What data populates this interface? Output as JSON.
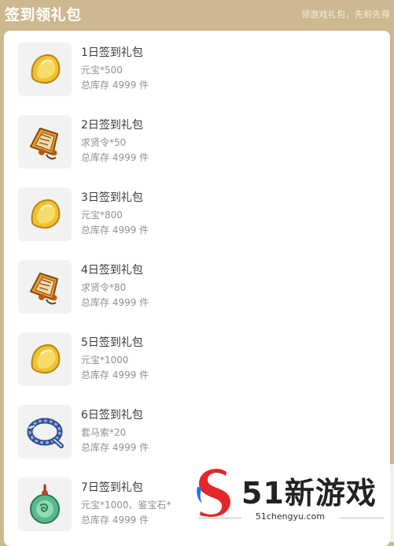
{
  "header": {
    "title": "签到领礼包",
    "note": "领游戏礼包，先到先得"
  },
  "rewards": [
    {
      "title": "1日签到礼包",
      "desc": "元宝*500",
      "stock": "总库存 4999 件",
      "icon": "gold-ingot-icon"
    },
    {
      "title": "2日签到礼包",
      "desc": "求贤令*50",
      "stock": "总库存 4999 件",
      "icon": "recruit-token-icon"
    },
    {
      "title": "3日签到礼包",
      "desc": "元宝*800",
      "stock": "总库存 4999 件",
      "icon": "gold-ingot-icon"
    },
    {
      "title": "4日签到礼包",
      "desc": "求贤令*80",
      "stock": "总库存 4999 件",
      "icon": "recruit-token-icon"
    },
    {
      "title": "5日签到礼包",
      "desc": "元宝*1000",
      "stock": "总库存 4999 件",
      "icon": "gold-ingot-icon"
    },
    {
      "title": "6日签到礼包",
      "desc": "套马索*20",
      "stock": "总库存 4999 件",
      "icon": "lasso-rope-icon"
    },
    {
      "title": "7日签到礼包",
      "desc": "元宝*1000、鉴宝石*",
      "stock": "总库存 4999 件",
      "icon": "jade-pendant-icon"
    }
  ],
  "watermark": {
    "brand": "51新游戏",
    "url": "51chengyu.com",
    "logo_icon": "s-swirl-logo"
  },
  "colors": {
    "background": "#cdb890",
    "panel": "#ffffff",
    "thumb_bg": "#f2f2f2",
    "title_text": "#3a3a3a",
    "meta_text": "#909090",
    "logo_red": "#e3262b",
    "logo_blue": "#2a6fd6"
  }
}
